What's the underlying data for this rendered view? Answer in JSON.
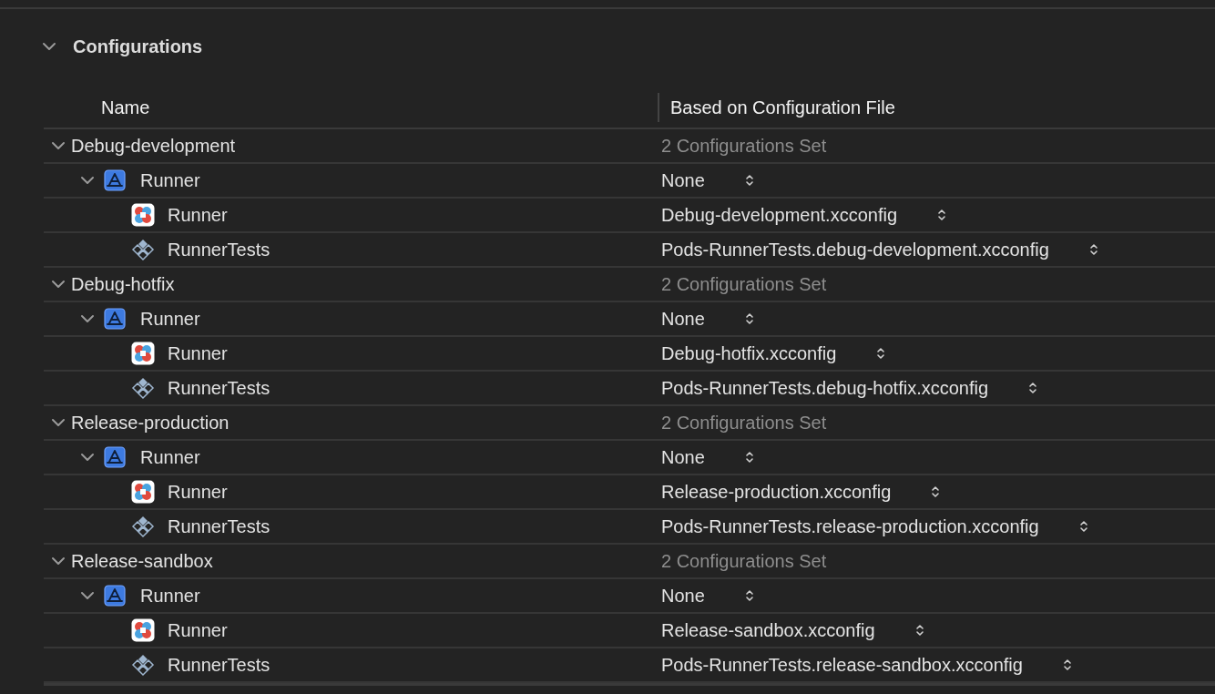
{
  "section": {
    "title": "Configurations",
    "expanded": true
  },
  "table": {
    "columns": [
      "Name",
      "Based on Configuration File"
    ],
    "configurations": [
      {
        "name": "Debug-development",
        "expanded": true,
        "summary": "2 Configurations Set",
        "project": {
          "name": "Runner",
          "expanded": true,
          "value": "None",
          "targets": [
            {
              "kind": "app",
              "name": "Runner",
              "value": "Debug-development.xcconfig"
            },
            {
              "kind": "tests",
              "name": "RunnerTests",
              "value": "Pods-RunnerTests.debug-development.xcconfig"
            }
          ]
        }
      },
      {
        "name": "Debug-hotfix",
        "expanded": true,
        "summary": "2 Configurations Set",
        "project": {
          "name": "Runner",
          "expanded": true,
          "value": "None",
          "targets": [
            {
              "kind": "app",
              "name": "Runner",
              "value": "Debug-hotfix.xcconfig"
            },
            {
              "kind": "tests",
              "name": "RunnerTests",
              "value": "Pods-RunnerTests.debug-hotfix.xcconfig"
            }
          ]
        }
      },
      {
        "name": "Release-production",
        "expanded": true,
        "summary": "2 Configurations Set",
        "project": {
          "name": "Runner",
          "expanded": true,
          "value": "None",
          "targets": [
            {
              "kind": "app",
              "name": "Runner",
              "value": "Release-production.xcconfig"
            },
            {
              "kind": "tests",
              "name": "RunnerTests",
              "value": "Pods-RunnerTests.release-production.xcconfig"
            }
          ]
        }
      },
      {
        "name": "Release-sandbox",
        "expanded": true,
        "summary": "2 Configurations Set",
        "project": {
          "name": "Runner",
          "expanded": true,
          "value": "None",
          "targets": [
            {
              "kind": "app",
              "name": "Runner",
              "value": "Release-sandbox.xcconfig"
            },
            {
              "kind": "tests",
              "name": "RunnerTests",
              "value": "Pods-RunnerTests.release-sandbox.xcconfig"
            }
          ]
        }
      }
    ]
  }
}
